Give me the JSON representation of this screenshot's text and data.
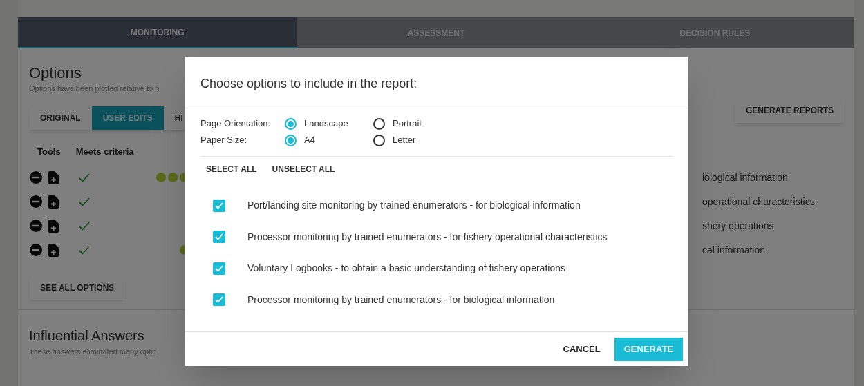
{
  "tabs": [
    {
      "label": "MONITORING",
      "selected": true
    },
    {
      "label": "ASSESSMENT",
      "selected": false
    },
    {
      "label": "DECISION RULES",
      "selected": false
    }
  ],
  "options": {
    "title": "Options",
    "subtitle": "Options have been plotted relative to h",
    "view_tabs": [
      {
        "label": "ORIGINAL",
        "selected": false
      },
      {
        "label": "USER EDITS",
        "selected": true
      },
      {
        "label": "HI",
        "selected": false
      }
    ],
    "generate_button": "GENERATE REPORTS",
    "columns": [
      "Tools",
      "Meets criteria"
    ],
    "rows": [
      {
        "meets": true,
        "kind": "three_dots",
        "text": "iological information"
      },
      {
        "meets": true,
        "kind": "no_dots",
        "text": "operational characteristics"
      },
      {
        "meets": true,
        "kind": "no_dots",
        "text": "shery operations"
      },
      {
        "meets": true,
        "kind": "one_dot",
        "text": "cal information"
      }
    ],
    "see_all_button": "SEE ALL OPTIONS"
  },
  "influential": {
    "title": "Influential Answers",
    "subtitle": "These answers eliminated many optio"
  },
  "dialog": {
    "title": "Choose options to include in the report:",
    "settings": [
      {
        "label": "Page Orientation:",
        "choices": [
          {
            "label": "Landscape",
            "selected": true
          },
          {
            "label": "Portrait",
            "selected": false
          }
        ]
      },
      {
        "label": "Paper Size:",
        "choices": [
          {
            "label": "A4",
            "selected": true
          },
          {
            "label": "Letter",
            "selected": false
          }
        ]
      }
    ],
    "select_all": "SELECT ALL",
    "unselect_all": "UNSELECT ALL",
    "items": [
      {
        "label": "Port/landing site monitoring by trained enumerators - for biological information",
        "checked": true
      },
      {
        "label": "Processor monitoring by trained enumerators - for fishery operational characteristics",
        "checked": true
      },
      {
        "label": "Voluntary Logbooks - to obtain a basic understanding of fishery operations",
        "checked": true
      },
      {
        "label": "Processor monitoring by trained enumerators - for biological information",
        "checked": true
      }
    ],
    "cancel": "CANCEL",
    "generate": "GENERATE"
  }
}
